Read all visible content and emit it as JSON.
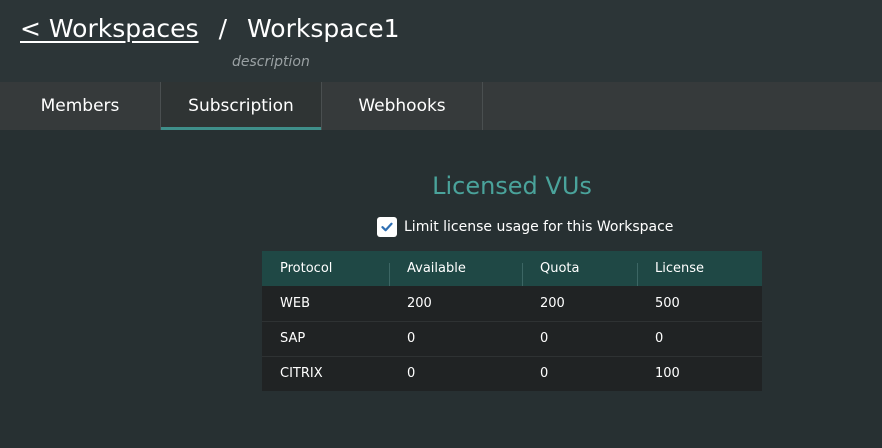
{
  "breadcrumb": {
    "back_label": "< Workspaces",
    "separator": "/",
    "current": "Workspace1"
  },
  "workspace": {
    "description": "description"
  },
  "tabs": [
    {
      "label": "Members",
      "active": false
    },
    {
      "label": "Subscription",
      "active": true
    },
    {
      "label": "Webhooks",
      "active": false
    }
  ],
  "licensed": {
    "title": "Licensed VUs",
    "limit_checkbox_label": "Limit license usage for this Workspace",
    "limit_checked": true,
    "columns": [
      "Protocol",
      "Available",
      "Quota",
      "License"
    ],
    "rows": [
      [
        "WEB",
        "200",
        "200",
        "500"
      ],
      [
        "SAP",
        "0",
        "0",
        "0"
      ],
      [
        "CITRIX",
        "0",
        "0",
        "100"
      ]
    ]
  },
  "colors": {
    "accent": "#4aa39b",
    "table_header": "#1f4845",
    "background": "#273032"
  }
}
